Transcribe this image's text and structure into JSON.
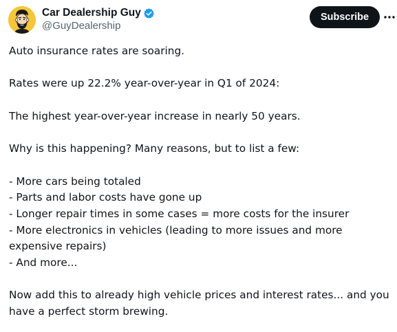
{
  "author": {
    "display_name": "Car Dealership Guy",
    "handle": "@GuyDealership",
    "verified": true,
    "avatar_icon": "cartoon-face-avatar",
    "avatar_bg": "#f5c63a"
  },
  "actions": {
    "subscribe_label": "Subscribe",
    "more_icon": "more-horizontal-icon"
  },
  "tweet": {
    "intro": "Auto insurance rates are soaring.",
    "stat": "Rates were up 22.2% year-over-year in Q1 of 2024:",
    "highlight": "The highest year-over-year increase in nearly 50 years.",
    "question": "Why is this happening? Many reasons, but to list a few:",
    "reasons": [
      "- More cars being totaled",
      "- Parts and labor costs have gone up",
      "- Longer repair times in some cases = more costs for the insurer",
      "- More electronics in vehicles (leading to more issues and more expensive repairs)",
      "- And more..."
    ],
    "conclusion": "Now add this to already high vehicle prices and interest rates... and you have a perfect storm brewing."
  },
  "colors": {
    "text": "#0f1419",
    "secondary": "#536471",
    "verified": "#1d9bf0",
    "button_bg": "#0f1419",
    "button_text": "#ffffff"
  }
}
